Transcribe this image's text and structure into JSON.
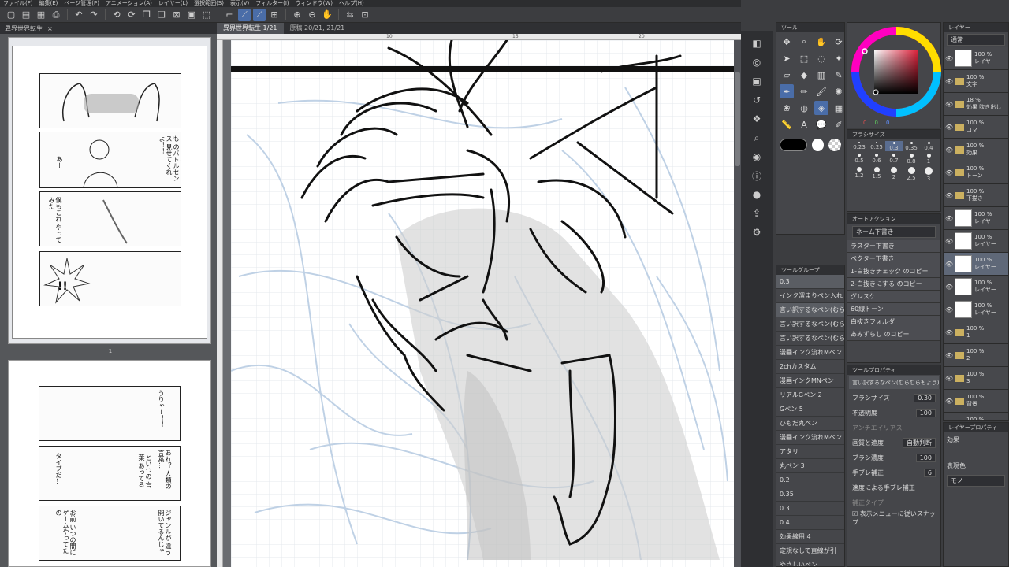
{
  "menu": [
    "ファイル(F)",
    "編集(E)",
    "ページ管理(P)",
    "アニメーション(A)",
    "レイヤー(L)",
    "選択範囲(S)",
    "表示(V)",
    "フィルター(I)",
    "ウィンドウ(W)",
    "ヘルプ(H)"
  ],
  "toolbar": {
    "icons": [
      "new-icon",
      "open-icon",
      "save-icon",
      "print-icon",
      "undo-icon",
      "redo-icon",
      "rotate-left-icon",
      "rotate-right-icon",
      "zoom-in-icon",
      "zoom-out-icon",
      "hand-icon"
    ]
  },
  "navigator": {
    "tab": "異界世界転生",
    "page_label": "1",
    "page1_texts": [
      "タツー 早くいつも のバトルセンス 見せてくれ よ！！",
      "あー",
      "僕もこれ やってみた",
      "!!"
    ],
    "page2_texts": [
      "うりゃー！！",
      "あれ？ 人類の 言葉…",
      "といつの 言葉 あってる",
      "タイプだ…",
      "お前 いつの間に ゲームやってたの",
      "ジャンルが 違う 開いてるんじゃ"
    ]
  },
  "canvas": {
    "tabs": [
      "異界世界転生 1/21",
      "原稿 20/21, 21/21"
    ],
    "ruler_marks": [
      "10",
      "15",
      "20"
    ]
  },
  "color": {
    "accent": "#4a6da8",
    "values": [
      "0",
      "0",
      "0"
    ],
    "ring_label": "カラーサークル"
  },
  "tools": {
    "title": "ツール",
    "brush_size_title": "ブラシサイズ",
    "sizes": [
      "0.23",
      "0.25",
      "0.3",
      "0.35",
      "0.4",
      "0.5",
      "0.6",
      "0.7",
      "0.8",
      "1",
      "1.2",
      "1.5",
      "2",
      "2.5",
      "3"
    ],
    "auto_action_title": "オートアクション",
    "auto_action_select": "ネーム下書き",
    "auto_actions": [
      "ラスター下書き",
      "ベクター下書き",
      "1-白抜きチェック のコピー",
      "2-白抜きにする のコピー",
      "グレスケ",
      "60線トーン",
      "白抜きフォルダ",
      "あみずらし のコピー"
    ]
  },
  "subtools": {
    "header": "ツールグループ",
    "current": "0.3",
    "items": [
      "インク溜まりペン入れ",
      "言い訳するなペン(むら",
      "言い訳するなペン(むら",
      "言い訳するなペン(むら",
      "漫画インク流れMペン",
      "2chカスタム",
      "漫画インクMNペン",
      "リアルGペン 2",
      "Gペン 5",
      "ひもだ丸ペン",
      "漫画インク流れMペン",
      "アタリ",
      "丸ペン 3",
      "0.2",
      "0.35",
      "0.3",
      "0.4",
      "効果線用 4",
      "定規なしで直線が引",
      "やさしいペン"
    ]
  },
  "toolprop": {
    "title": "ツールプロパティ",
    "name": "言い訳するなペン(むらむらもよう) 4",
    "rows": [
      {
        "label": "ブラシサイズ",
        "value": "0.30"
      },
      {
        "label": "不透明度",
        "value": "100"
      },
      {
        "label": "アンチエイリアス",
        "value": ""
      },
      {
        "label": "画質と速度",
        "value": "自動判断"
      },
      {
        "label": "ブラシ濃度",
        "value": "100"
      },
      {
        "label": "手ブレ補正",
        "value": "6"
      },
      {
        "label": "速度による手ブレ補正",
        "value": ""
      },
      {
        "label": "補正タイプ",
        "value": ""
      },
      {
        "label": "表示メニューに従いスナップ",
        "value": ""
      }
    ]
  },
  "layers": {
    "title": "レイヤー",
    "blend": "通常",
    "rows": [
      {
        "pct": "100 %",
        "name": "レイヤー",
        "type": "layer"
      },
      {
        "pct": "100 %",
        "name": "文字",
        "type": "folder"
      },
      {
        "pct": "18 %",
        "name": "効果 吹き出し",
        "type": "folder"
      },
      {
        "pct": "100 %",
        "name": "コマ",
        "type": "folder"
      },
      {
        "pct": "100 %",
        "name": "効果",
        "type": "folder"
      },
      {
        "pct": "100 %",
        "name": "トーン",
        "type": "folder"
      },
      {
        "pct": "100 %",
        "name": "下描き",
        "type": "folder"
      },
      {
        "pct": "100 %",
        "name": "レイヤー",
        "type": "layer"
      },
      {
        "pct": "100 %",
        "name": "レイヤー",
        "type": "layer"
      },
      {
        "pct": "100 %",
        "name": "レイヤー",
        "type": "layer"
      },
      {
        "pct": "100 %",
        "name": "レイヤー",
        "type": "layer"
      },
      {
        "pct": "100 %",
        "name": "レイヤー",
        "type": "layer"
      },
      {
        "pct": "100 %",
        "name": "1",
        "type": "folder"
      },
      {
        "pct": "100 %",
        "name": "2",
        "type": "folder"
      },
      {
        "pct": "100 %",
        "name": "3",
        "type": "folder"
      },
      {
        "pct": "100 %",
        "name": "背景",
        "type": "folder"
      },
      {
        "pct": "100 %",
        "name": "フォルダ",
        "type": "folder"
      }
    ],
    "prop_title": "レイヤープロパティ",
    "effect": "効果",
    "color_label": "表現色",
    "color_value": "モノ"
  }
}
